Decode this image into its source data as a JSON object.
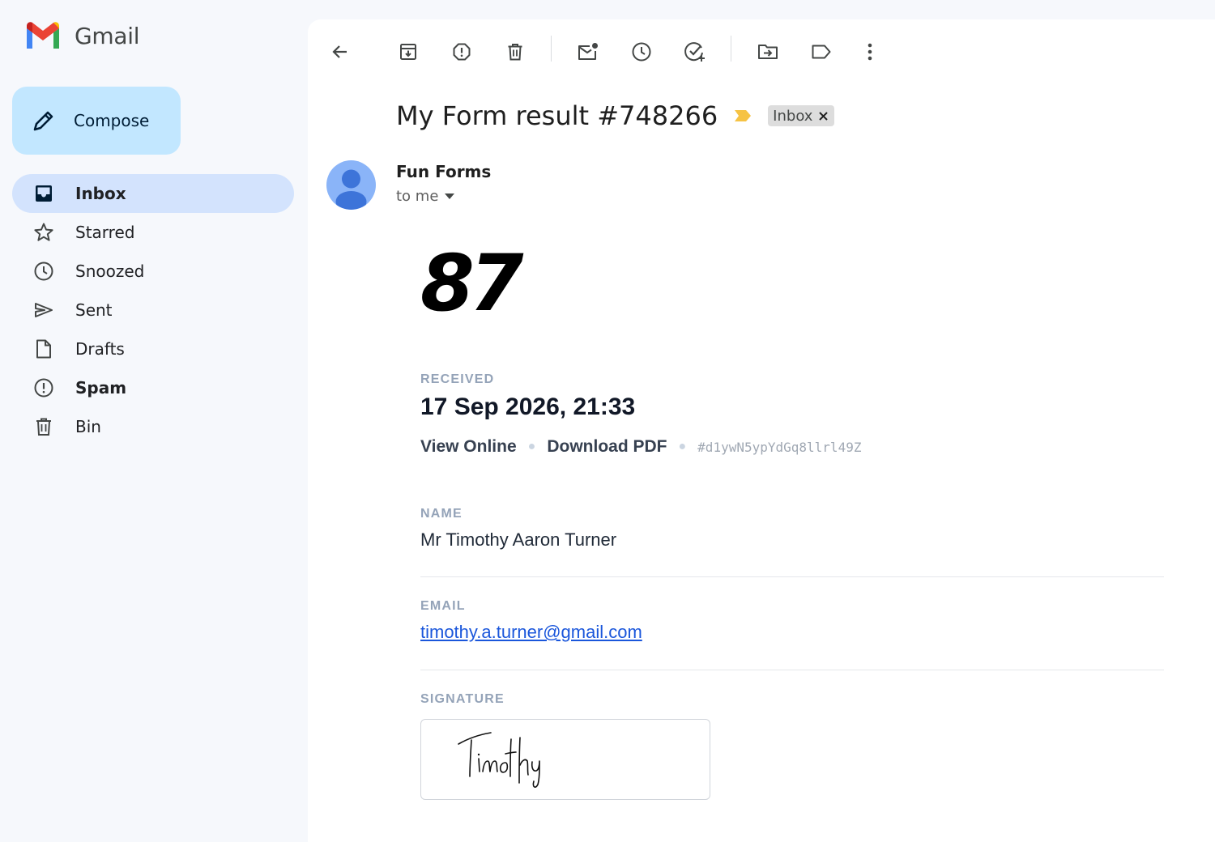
{
  "app": {
    "brand": "Gmail",
    "colors": {
      "compose_bg": "#c2e7ff",
      "active_nav": "#d3e3fd",
      "link": "#1a56db",
      "label_marker": "#f6c344"
    }
  },
  "sidebar": {
    "compose_label": "Compose",
    "items": [
      {
        "label": "Inbox",
        "icon": "inbox-icon"
      },
      {
        "label": "Starred",
        "icon": "star-icon"
      },
      {
        "label": "Snoozed",
        "icon": "clock-icon"
      },
      {
        "label": "Sent",
        "icon": "send-icon"
      },
      {
        "label": "Drafts",
        "icon": "draft-icon"
      },
      {
        "label": "Spam",
        "icon": "spam-icon"
      },
      {
        "label": "Bin",
        "icon": "trash-icon"
      }
    ]
  },
  "toolbar": {
    "icons": [
      "back-arrow-icon",
      "archive-icon",
      "report-spam-icon",
      "delete-icon",
      "mark-unread-icon",
      "snooze-icon",
      "add-task-icon",
      "move-to-icon",
      "label-icon",
      "more-vert-icon"
    ]
  },
  "message": {
    "subject": "My Form result #748266",
    "label_chip": "Inbox",
    "sender": "Fun Forms",
    "recipient_line": "to me"
  },
  "form": {
    "score": "87",
    "received_label": "RECEIVED",
    "received_value": "17 Sep 2026, 21:33",
    "view_online": "View Online",
    "download_pdf": "Download PDF",
    "submission_id": "#d1ywN5ypYdGq8llrl49Z",
    "name_label": "NAME",
    "name_value": "Mr Timothy Aaron Turner",
    "email_label": "EMAIL",
    "email_value": "timothy.a.turner@gmail.com",
    "signature_label": "SIGNATURE",
    "signature_text": "Timothy"
  }
}
